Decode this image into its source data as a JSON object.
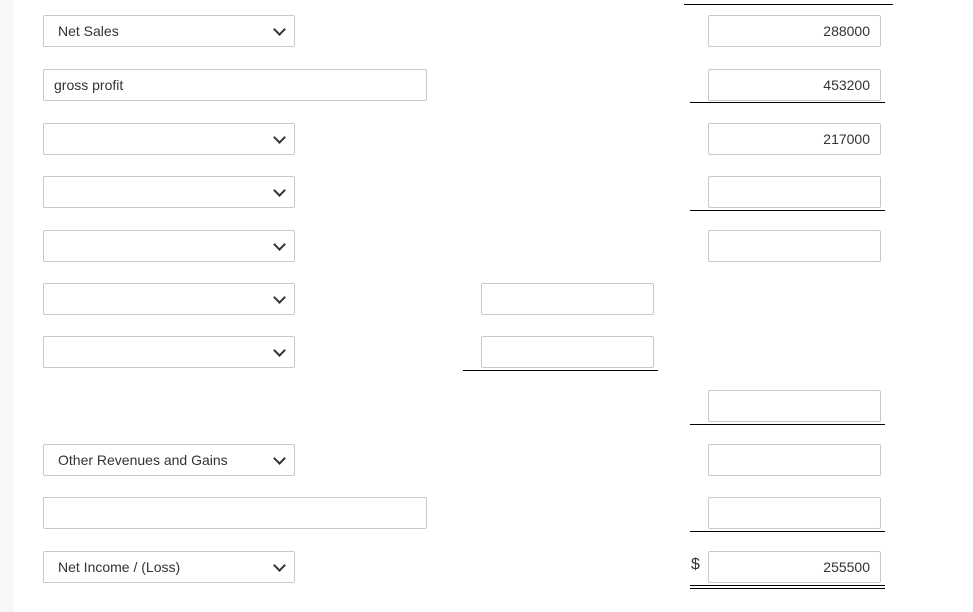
{
  "rows": {
    "r1": {
      "select": "Net Sales",
      "amount": "288000"
    },
    "r2": {
      "text": "gross profit",
      "amount": "453200"
    },
    "r3": {
      "select": "",
      "amount": "217000"
    },
    "r4": {
      "select": "",
      "amount": ""
    },
    "r5": {
      "select": "",
      "amount": ""
    },
    "r6": {
      "select": "",
      "sub": ""
    },
    "r7": {
      "select": "",
      "sub": ""
    },
    "r8": {
      "amount": ""
    },
    "r9": {
      "select": "Other Revenues and Gains",
      "amount": ""
    },
    "r10": {
      "text": "",
      "amount": ""
    },
    "r11": {
      "select": "Net Income / (Loss)",
      "currency": "$",
      "amount": "255500"
    }
  },
  "icons": {
    "dropdown": "chevron-down-icon"
  }
}
